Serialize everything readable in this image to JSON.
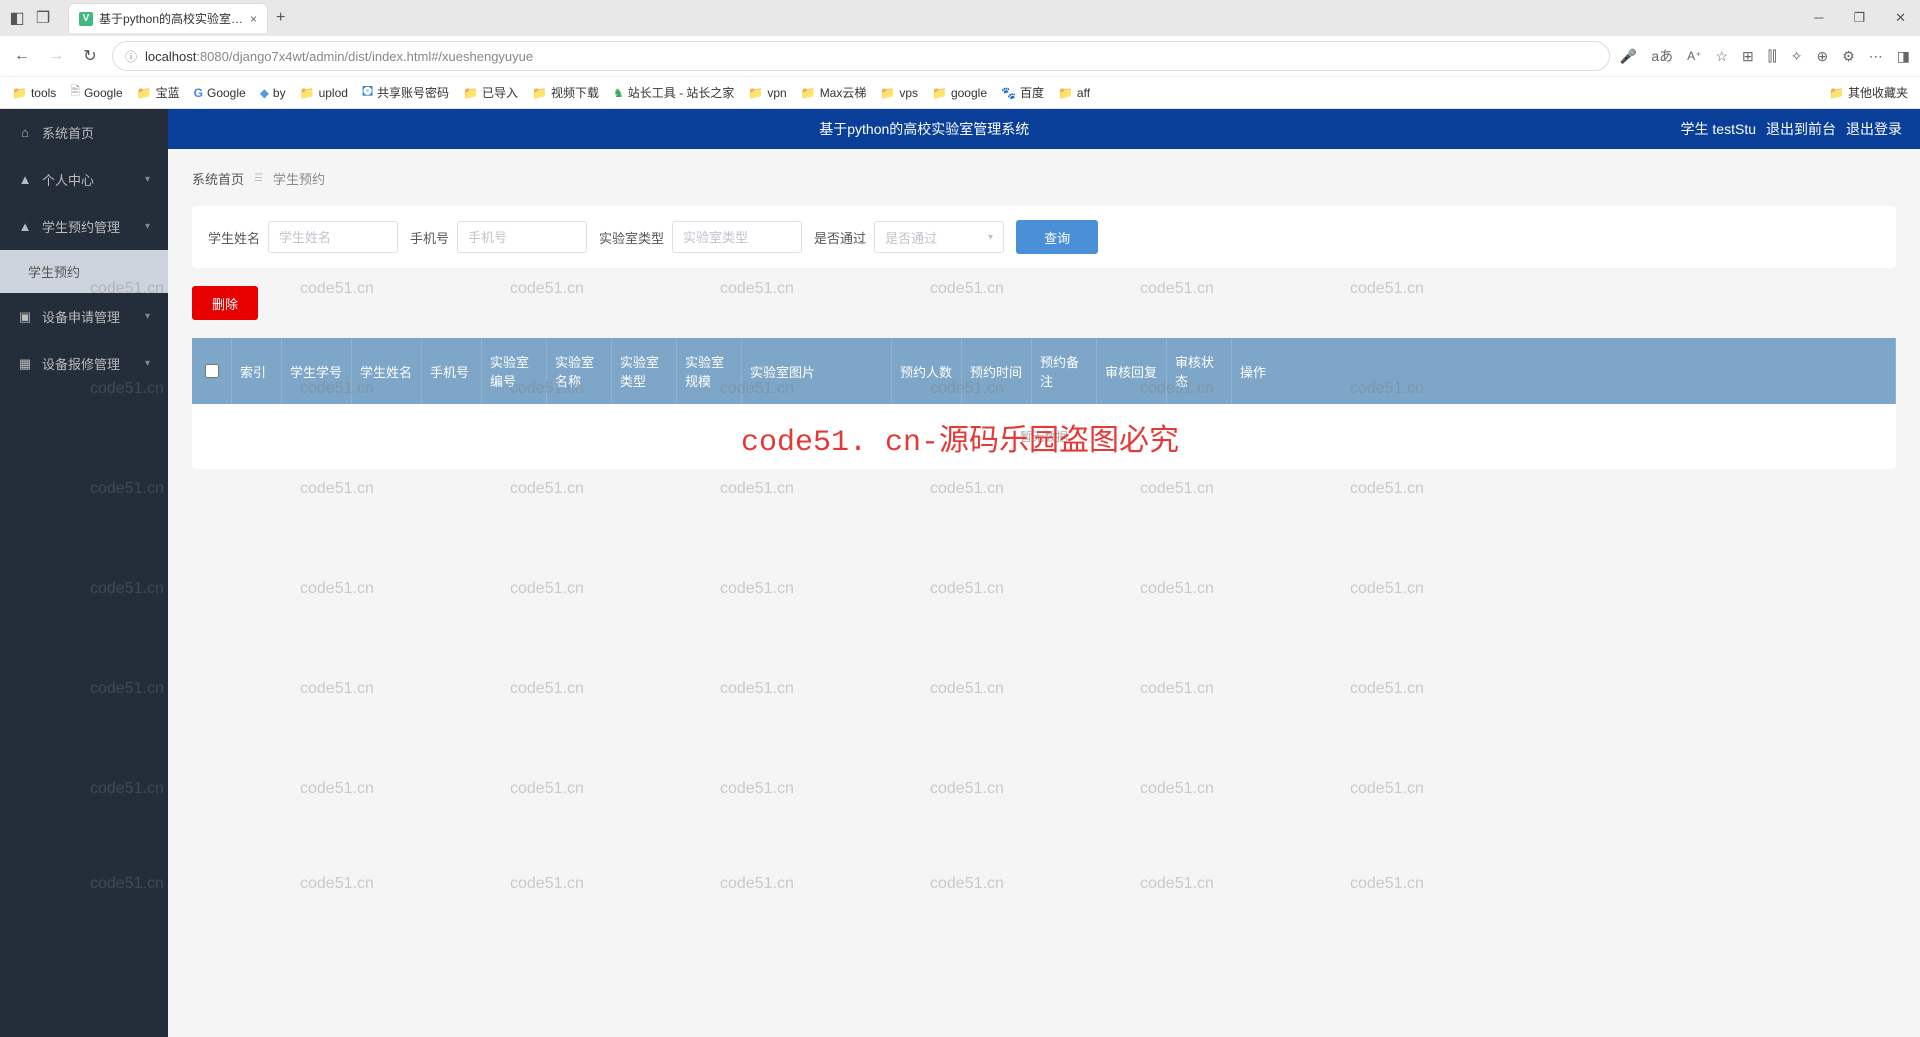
{
  "browser": {
    "tab_title": "基于python的高校实验室管理系统",
    "url_host": "localhost",
    "url_port": ":8080",
    "url_path": "/django7x4wt/admin/dist/index.html#/xueshengyuyue",
    "bookmarks": [
      {
        "label": "tools",
        "type": "folder"
      },
      {
        "label": "Google",
        "type": "page"
      },
      {
        "label": "宝蓝",
        "type": "folder"
      },
      {
        "label": "Google",
        "type": "google"
      },
      {
        "label": "by",
        "type": "link"
      },
      {
        "label": "uplod",
        "type": "folder"
      },
      {
        "label": "共享账号密码",
        "type": "app"
      },
      {
        "label": "已导入",
        "type": "folder"
      },
      {
        "label": "视频下载",
        "type": "folder"
      },
      {
        "label": "站长工具 - 站长之家",
        "type": "app"
      },
      {
        "label": "vpn",
        "type": "folder"
      },
      {
        "label": "Max云梯",
        "type": "folder"
      },
      {
        "label": "vps",
        "type": "folder"
      },
      {
        "label": "google",
        "type": "folder"
      },
      {
        "label": "百度",
        "type": "app"
      },
      {
        "label": "aff",
        "type": "folder"
      }
    ],
    "other_bookmarks": "其他收藏夹"
  },
  "app": {
    "title": "基于python的高校实验室管理系统",
    "user_label": "学生 testStu",
    "exit_front": "退出到前台",
    "logout": "退出登录"
  },
  "sidebar": {
    "items": [
      {
        "label": "系统首页",
        "icon": "home"
      },
      {
        "label": "个人中心",
        "icon": "user",
        "expandable": true
      },
      {
        "label": "学生预约管理",
        "icon": "user",
        "expandable": true
      },
      {
        "label": "设备申请管理",
        "icon": "doc",
        "expandable": true
      },
      {
        "label": "设备报修管理",
        "icon": "grid",
        "expandable": true
      }
    ],
    "sub_item": "学生预约"
  },
  "breadcrumb": {
    "home": "系统首页",
    "current": "学生预约"
  },
  "search": {
    "name_label": "学生姓名",
    "name_placeholder": "学生姓名",
    "phone_label": "手机号",
    "phone_placeholder": "手机号",
    "labtype_label": "实验室类型",
    "labtype_placeholder": "实验室类型",
    "pass_label": "是否通过",
    "pass_placeholder": "是否通过",
    "query_btn": "查询"
  },
  "actions": {
    "delete": "删除"
  },
  "table": {
    "headers": {
      "idx": "索引",
      "sid": "学生学号",
      "name": "学生姓名",
      "phone": "手机号",
      "labno": "实验室编号",
      "labname": "实验室名称",
      "labtype": "实验室类型",
      "labscale": "实验室规模",
      "labimg": "实验室图片",
      "count": "预约人数",
      "time": "预约时间",
      "remark": "预约备注",
      "reply": "审核回复",
      "status": "审核状态",
      "op": "操作"
    },
    "empty": "暂无数据"
  },
  "watermark": {
    "text": "code51.cn",
    "center": "code51. cn-源码乐园盗图必究"
  }
}
